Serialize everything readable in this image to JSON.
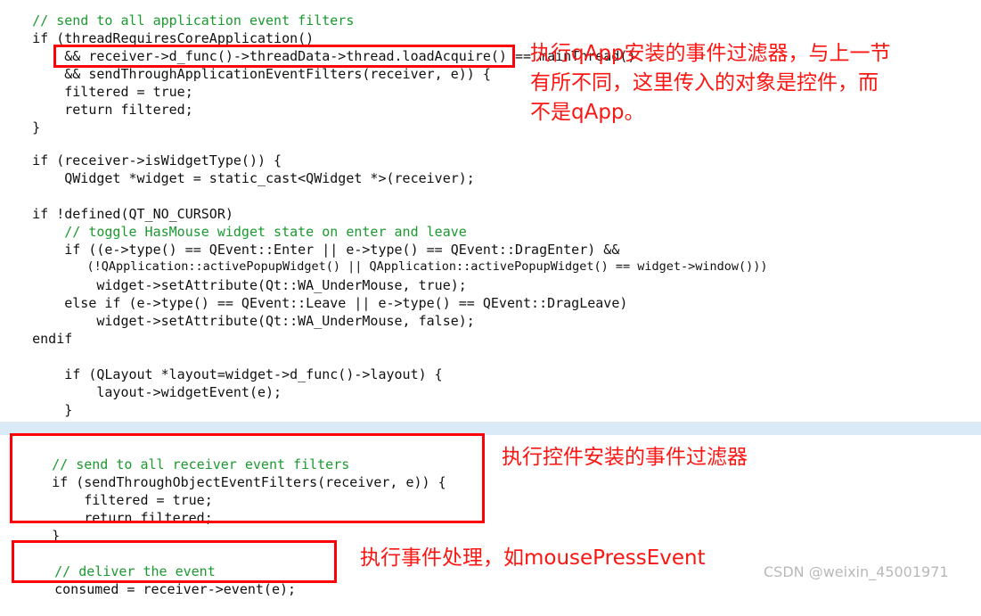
{
  "page": {
    "title": "Qt source code screenshot with annotations",
    "background_color": "#ffffff",
    "highlight_band_color": "#daeaf7",
    "annotation_color": "#fb1612",
    "box_border_color": "#fb0007"
  },
  "code_block_top": {
    "lines": [
      "// send to all application event filters",
      "if (threadRequiresCoreApplication()",
      "    && receiver->d_func()->threadData->thread.loadAcquire() == mainThread()",
      "    && sendThroughApplicationEventFilters(receiver, e)) {",
      "    filtered = true;",
      "    return filtered;",
      "}"
    ]
  },
  "code_block_widget": {
    "lines": [
      "if (receiver->isWidgetType()) {",
      "    QWidget *widget = static_cast<QWidget *>(receiver);"
    ]
  },
  "code_block_cursor": {
    "lines": [
      "if !defined(QT_NO_CURSOR)",
      "    // toggle HasMouse widget state on enter and leave",
      "    if ((e->type() == QEvent::Enter || e->type() == QEvent::DragEnter) &&",
      "        (!QApplication::activePopupWidget() || QApplication::activePopupWidget() == widget->window()))",
      "        widget->setAttribute(Qt::WA_UnderMouse, true);",
      "    else if (e->type() == QEvent::Leave || e->type() == QEvent::DragLeave)",
      "        widget->setAttribute(Qt::WA_UnderMouse, false);",
      "endif"
    ]
  },
  "code_block_layout": {
    "lines": [
      "    if (QLayout *layout=widget->d_func()->layout) {",
      "        layout->widgetEvent(e);",
      "    }",
      "}"
    ]
  },
  "code_block_receiver_filters": {
    "lines": [
      "// send to all receiver event filters",
      "if (sendThroughObjectEventFilters(receiver, e)) {",
      "    filtered = true;",
      "    return filtered;",
      "}"
    ]
  },
  "code_block_deliver": {
    "lines": [
      "// deliver the event",
      "consumed = receiver->event(e);"
    ]
  },
  "annotations": {
    "app_filters": "执行qApp安装的事件过滤器，与上一节\n有所不同，这里传入的对象是控件，而\n不是qApp。",
    "object_filters": "执行控件安装的事件过滤器",
    "deliver_event": "执行事件处理，如mousePressEvent"
  },
  "watermark": {
    "text": "CSDN @weixin_45001971"
  }
}
